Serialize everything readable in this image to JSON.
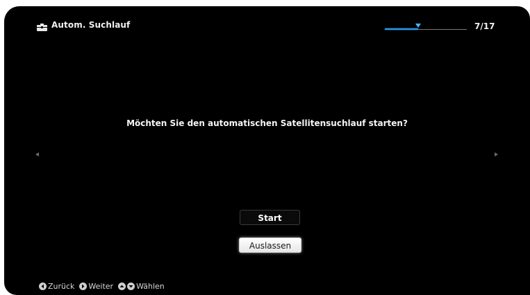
{
  "header": {
    "title": "Autom. Suchlauf",
    "title_icon": "toolbox-icon",
    "page_count": "7/17",
    "progress_fraction": 0.41
  },
  "main": {
    "question": "Möchten Sie den automatischen Satellitensuchlauf starten?",
    "buttons": {
      "start_label": "Start",
      "skip_label": "Auslassen"
    },
    "nav_left_icon": "chevron-left-icon",
    "nav_right_icon": "chevron-right-icon"
  },
  "footer": {
    "back_label": "Zurück",
    "next_label": "Weiter",
    "select_label": "Wählen"
  },
  "colors": {
    "accent": "#2f9be6",
    "background": "#000000",
    "text": "#f2f2f2"
  }
}
